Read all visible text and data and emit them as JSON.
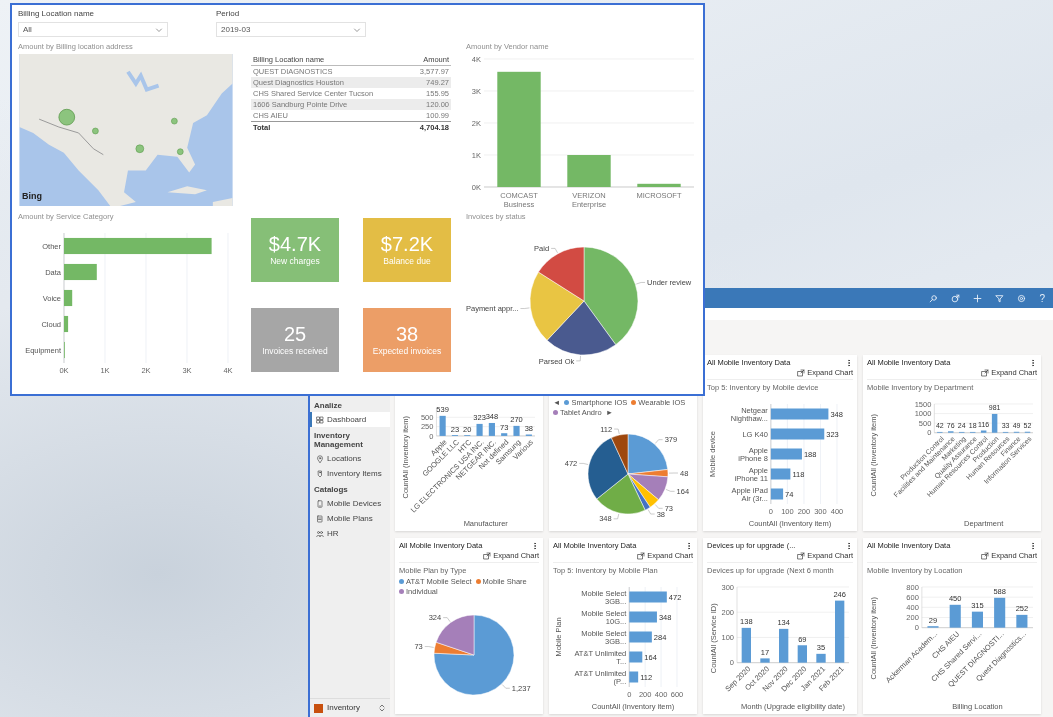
{
  "report": {
    "filters": [
      {
        "label": "Billing Location name",
        "value": "All"
      },
      {
        "label": "Period",
        "value": "2019-03"
      }
    ],
    "map": {
      "title": "Amount by Billing location address",
      "credit": "Bing"
    },
    "table": {
      "columns": [
        "Billing Location name",
        "Amount"
      ],
      "rows": [
        [
          "QUEST DIAGNOSTICS",
          "3,577.97"
        ],
        [
          "Quest Diagnostics Houston",
          "749.27"
        ],
        [
          "CHS Shared Service Center Tucson",
          "155.95"
        ],
        [
          "1606 Sandburg Pointe Drive",
          "120.00"
        ],
        [
          "CHS AIEU",
          "100.99"
        ]
      ],
      "total": [
        "Total",
        "4,704.18"
      ]
    },
    "vendor_chart": {
      "chart_data": {
        "type": "bar",
        "title": "Amount by Vendor name",
        "categories": [
          "COMCAST Business",
          "VERIZON Enterprise",
          "MICROSOFT"
        ],
        "series": [
          {
            "color": "#74b865",
            "values": [
              3600,
              1000,
              100
            ]
          }
        ],
        "ylim": [
          0,
          4000
        ],
        "grid": true,
        "yticks": [
          {
            "value": 0,
            "label": "0K"
          },
          {
            "value": 1000,
            "label": "1K"
          },
          {
            "value": 2000,
            "label": "2K"
          },
          {
            "value": 3000,
            "label": "3K"
          },
          {
            "value": 4000,
            "label": "4K"
          }
        ]
      }
    },
    "category_chart": {
      "chart_data": {
        "type": "bar",
        "orientation": "horizontal",
        "title": "Amount by Service Category",
        "categories": [
          "Other",
          "Data",
          "Voice",
          "Cloud",
          "Equipment"
        ],
        "series": [
          {
            "color": "#74b865",
            "values": [
              3600,
              800,
              200,
              100,
              0
            ]
          }
        ],
        "xlim": [
          0,
          4000
        ],
        "grid": true,
        "xticks": [
          {
            "value": 0,
            "label": "0K"
          },
          {
            "value": 1000,
            "label": "1K"
          },
          {
            "value": 2000,
            "label": "2K"
          },
          {
            "value": 3000,
            "label": "3K"
          },
          {
            "value": 4000,
            "label": "4K"
          }
        ]
      }
    },
    "kpis": [
      {
        "value": "$4.7K",
        "label": "New charges",
        "color": "#86bf77"
      },
      {
        "value": "$7.2K",
        "label": "Balance due",
        "color": "#e3bd45"
      },
      {
        "value": "25",
        "label": "Invoices received",
        "color": "#a6a6a6"
      },
      {
        "value": "38",
        "label": "Expected invoices",
        "color": "#ec9e67"
      }
    ],
    "status_chart": {
      "chart_data": {
        "type": "pie",
        "title": "Invoices by status",
        "categories": [
          "Under review",
          "Parsed Ok",
          "Payment appr...",
          "Paid"
        ],
        "values": [
          40,
          22,
          22,
          16
        ],
        "colors": [
          "#74b865",
          "#4a5a8f",
          "#e9c543",
          "#d24b43"
        ]
      }
    }
  },
  "app": {
    "header": {
      "help": "?"
    },
    "sidebar": {
      "groups": [
        {
          "title": "Analize",
          "items": [
            {
              "label": "Dashboard",
              "selected": true
            }
          ]
        },
        {
          "title": "Inventory Management",
          "items": [
            {
              "label": "Locations",
              "selected": false
            },
            {
              "label": "Inventory Items",
              "selected": false
            }
          ]
        },
        {
          "title": "Catalogs",
          "items": [
            {
              "label": "Mobile Devices",
              "selected": false
            },
            {
              "label": "Mobile Plans",
              "selected": false
            },
            {
              "label": "HR",
              "selected": false
            }
          ]
        }
      ],
      "area": "Inventory"
    },
    "cards": [
      {
        "chart_data": {
          "type": "bar",
          "categories": [
            "Apple",
            "GOOGLE LLC",
            "HTC",
            "LG ELECTRONICS USA INC.",
            "NETGEAR INC.",
            "Not defined",
            "Samsung",
            "Various"
          ],
          "series": [
            {
              "color": "#5b9bd5",
              "values": [
                539,
                23,
                20,
                323,
                348,
                73,
                270,
                38
              ]
            }
          ],
          "ylim": [
            0,
            750
          ],
          "grid": true,
          "yticks": [
            0,
            250,
            500
          ],
          "value_labels": [
            "539",
            "23",
            "20",
            "323",
            "348",
            "73",
            "270",
            "38"
          ],
          "xlabel": "Manufacturer",
          "ylabel": "CountAll (Inventory item)"
        }
      },
      {
        "legend": {
          "prev": "◄",
          "next": "►",
          "items": [
            {
              "label": "Smartphone IOS",
              "color": "#5b9bd5"
            },
            {
              "label": "Wearable IOS",
              "color": "#ed7d31"
            },
            {
              "label": "Tablet Andro",
              "color": "#a57fb9"
            }
          ]
        },
        "chart_data": {
          "type": "pie",
          "values": [
            379,
            48,
            164,
            73,
            38,
            348,
            472,
            112
          ],
          "colors": [
            "#5b9bd5",
            "#ed7d31",
            "#a57fb9",
            "#ffc000",
            "#4472c4",
            "#70ad47",
            "#255e91",
            "#9e480e"
          ],
          "value_labels": [
            "379",
            "48",
            "164",
            "73",
            "38",
            "348",
            "472",
            "112"
          ]
        }
      },
      {
        "title": "All Mobile Inventory Data",
        "action": "Expand Chart",
        "subtitle": "Top 5: Inventory by Mobile device",
        "chart_data": {
          "type": "bar",
          "orientation": "horizontal",
          "categories": [
            "Netgear Nighthaw...",
            "LG K40",
            "Apple iPhone 8",
            "Apple iPhone 11",
            "Apple iPad Air (3r..."
          ],
          "series": [
            {
              "color": "#5b9bd5",
              "values": [
                348,
                323,
                188,
                118,
                74
              ]
            }
          ],
          "xlim": [
            0,
            400
          ],
          "grid": true,
          "xticks": [
            0,
            100,
            200,
            300,
            400
          ],
          "value_labels": [
            "348",
            "323",
            "188",
            "118",
            "74"
          ],
          "xlabel": "CountAll (Inventory item)",
          "ylabel": "Mobile device"
        }
      },
      {
        "title": "All Mobile Inventory Data",
        "action": "Expand Chart",
        "subtitle": "Mobile Inventory by Department",
        "chart_data": {
          "type": "bar",
          "categories": [
            "Production Control",
            "Facilities and Maintenance",
            "Marketing",
            "Quality Assurance",
            "Human Resources Control",
            "Production",
            "Human Resources",
            "Finance",
            "Information Services"
          ],
          "series": [
            {
              "color": "#5b9bd5",
              "values": [
                42,
                76,
                24,
                18,
                116,
                981,
                33,
                49,
                52
              ]
            }
          ],
          "ylim": [
            0,
            1500
          ],
          "grid": true,
          "yticks": [
            0,
            500,
            1000,
            1500
          ],
          "value_labels": [
            "42",
            "76",
            "24",
            "18",
            "116",
            "981",
            "33",
            "49",
            "52"
          ],
          "xlabel": "Department",
          "ylabel": "CountAll (Inventory item)"
        }
      },
      {
        "title": "All Mobile Inventory Data",
        "action": "Expand Chart",
        "subtitle": "Mobile Plan by Type",
        "chart_data": {
          "type": "pie",
          "categories": [
            "AT&T Mobile Select",
            "Mobile Share",
            "Individual"
          ],
          "values": [
            1237,
            73,
            324
          ],
          "colors": [
            "#5b9bd5",
            "#ed7d31",
            "#a57fb9"
          ],
          "value_labels": [
            "1,237",
            "73",
            "324"
          ]
        }
      },
      {
        "title": "All Mobile Inventory Data",
        "action": "Expand Chart",
        "subtitle": "Top 5: Inventory by Mobile Plan",
        "chart_data": {
          "type": "bar",
          "orientation": "horizontal",
          "categories": [
            "Mobile Select 3GB...",
            "Mobile Select 10G...",
            "Mobile Select 3GB...",
            "AT&T Unlimited T...",
            "AT&T Unlimited (P..."
          ],
          "series": [
            {
              "color": "#5b9bd5",
              "values": [
                472,
                348,
                284,
                164,
                112
              ]
            }
          ],
          "xlim": [
            0,
            600
          ],
          "grid": true,
          "xticks": [
            0,
            200,
            400,
            600
          ],
          "value_labels": [
            "472",
            "348",
            "284",
            "164",
            "112"
          ],
          "xlabel": "CountAll (Inventory item)",
          "ylabel": "Mobile Plan"
        }
      },
      {
        "title": "Devices up for upgrade (...",
        "action": "Expand Chart",
        "subtitle": "Devices up for upgrade (Next 6 month",
        "chart_data": {
          "type": "bar",
          "categories": [
            "Sep 2020",
            "Oct 2020",
            "Nov 2020",
            "Dec 2020",
            "Jan 2021",
            "Feb 2021"
          ],
          "series": [
            {
              "color": "#5b9bd5",
              "values": [
                138,
                17,
                134,
                69,
                35,
                246
              ]
            }
          ],
          "ylim": [
            0,
            300
          ],
          "grid": true,
          "yticks": [
            0,
            100,
            200,
            300
          ],
          "value_labels": [
            "138",
            "17",
            "134",
            "69",
            "35",
            "246"
          ],
          "xlabel": "Month (Upgrade eligibility date)",
          "ylabel": "CountAll (Service ID)"
        }
      },
      {
        "title": "All Mobile Inventory Data",
        "action": "Expand Chart",
        "subtitle": "Mobile Inventory by Location",
        "chart_data": {
          "type": "bar",
          "categories": [
            "Ackerman Academ...",
            "CHS AIEU",
            "CHS Shared Servi...",
            "QUEST DIAGNOSTI...",
            "Quest Diagnostics..."
          ],
          "series": [
            {
              "color": "#5b9bd5",
              "values": [
                29,
                450,
                315,
                588,
                252
              ]
            }
          ],
          "ylim": [
            0,
            800
          ],
          "grid": true,
          "yticks": [
            0,
            200,
            400,
            600,
            800
          ],
          "value_labels": [
            "29",
            "450",
            "315",
            "588",
            "252"
          ],
          "xlabel": "Billing Location",
          "ylabel": "CountAll (Inventory item)"
        }
      }
    ]
  }
}
